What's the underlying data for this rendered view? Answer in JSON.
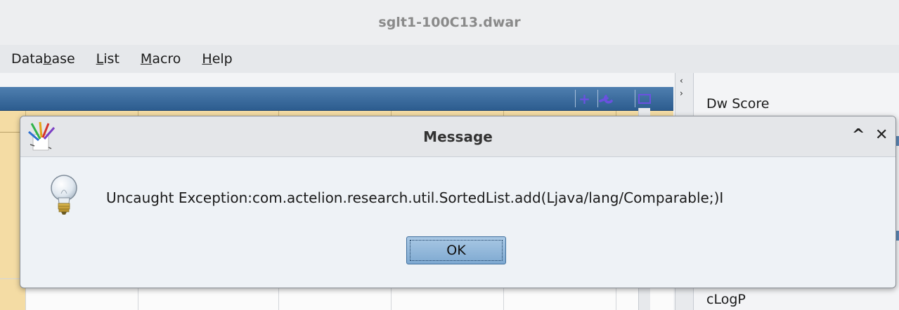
{
  "window": {
    "title": "sglt1-100C13.dwar"
  },
  "menubar": {
    "items": [
      {
        "pre": "Data",
        "mn": "b",
        "post": "ase"
      },
      {
        "pre": "",
        "mn": "L",
        "post": "ist"
      },
      {
        "pre": "",
        "mn": "M",
        "post": "acro"
      },
      {
        "pre": "",
        "mn": "H",
        "post": "elp"
      }
    ]
  },
  "toolbar": {
    "add_icon": "+"
  },
  "properties": {
    "label_top": "Dw Score",
    "label_bottom": "cLogP"
  },
  "dialog": {
    "title": "Message",
    "maximize_glyph": "^",
    "close_glyph": "✕",
    "message": "Uncaught Exception:com.actelion.research.util.SortedList.add(Ljava/lang/Comparable;)I",
    "ok_label": "OK"
  },
  "colors": {
    "toolbar_blue": "#3b6ca0",
    "header_tan": "#f4dca4",
    "button_blue": "#8fb6da"
  }
}
